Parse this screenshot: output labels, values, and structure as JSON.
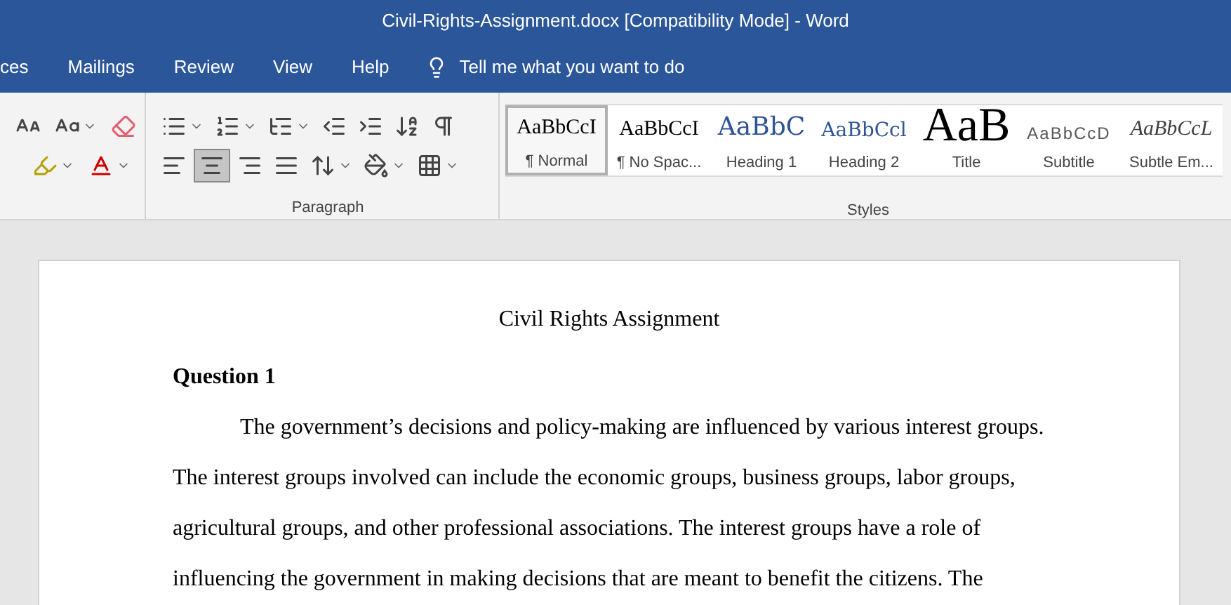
{
  "window": {
    "title": "Civil-Rights-Assignment.docx [Compatibility Mode]  -  Word"
  },
  "tabs": [
    {
      "label": "ces",
      "selected": false
    },
    {
      "label": "Mailings",
      "selected": false
    },
    {
      "label": "Review",
      "selected": false
    },
    {
      "label": "View",
      "selected": false
    },
    {
      "label": "Help",
      "selected": false
    }
  ],
  "tell_me": {
    "placeholder": "Tell me what you want to do"
  },
  "paragraph_group": {
    "label": "Paragraph",
    "align_center_selected": true
  },
  "styles_group": {
    "label": "Styles",
    "styles": [
      {
        "kind": "normal",
        "sample": "AaBbCcI",
        "name": "¶ Normal",
        "selected": true
      },
      {
        "kind": "nospacing",
        "sample": "AaBbCcI",
        "name": "¶ No Spac...",
        "selected": false
      },
      {
        "kind": "heading1",
        "sample": "AaBbC",
        "name": "Heading 1",
        "selected": false
      },
      {
        "kind": "heading2",
        "sample": "AaBbCcl",
        "name": "Heading 2",
        "selected": false
      },
      {
        "kind": "title",
        "sample": "AaB",
        "name": "Title",
        "selected": false
      },
      {
        "kind": "subtitle",
        "sample": "AaBbCcD",
        "name": "Subtitle",
        "selected": false
      },
      {
        "kind": "emphasis",
        "sample": "AaBbCcL",
        "name": "Subtle Em...",
        "selected": false
      }
    ]
  },
  "document": {
    "title": "Civil Rights Assignment",
    "heading": "Question 1",
    "paragraph": "The government’s decisions and policy-making are influenced by various interest groups. The interest groups involved can include the economic groups, business groups, labor groups, agricultural groups, and other professional associations. The interest groups have a role of influencing the government in making decisions that are meant to benefit the citizens. The"
  }
}
